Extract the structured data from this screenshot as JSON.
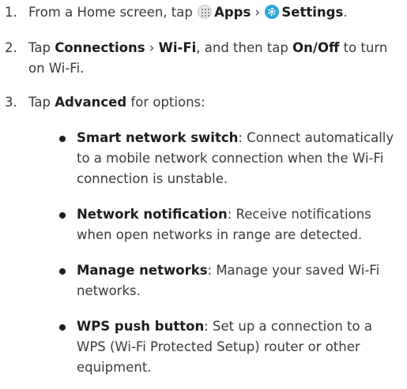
{
  "steps": [
    {
      "num": "1.",
      "pre": "From a Home screen, tap ",
      "apps": "Apps",
      "sep": " › ",
      "settings": "Settings",
      "post": "."
    },
    {
      "num": "2.",
      "pre": "Tap ",
      "connections": "Connections",
      "sep": " › ",
      "wifi": "Wi-Fi",
      "mid": ", and then tap ",
      "onoff": "On/Off",
      "post": " to turn on Wi-Fi."
    },
    {
      "num": "3.",
      "pre": "Tap ",
      "advanced": "Advanced",
      "post": " for options:"
    }
  ],
  "options": [
    {
      "term": "Smart network switch",
      "desc": ": Connect automatically to a mobile network connection when the Wi-Fi connection is unstable."
    },
    {
      "term": "Network notification",
      "desc": ": Receive notifications when open networks in range are detected."
    },
    {
      "term": "Manage networks",
      "desc": ": Manage your saved Wi-Fi networks."
    },
    {
      "term": "WPS push button",
      "desc": ": Set up a connection to a WPS (Wi-Fi Protected Setup) router or other equipment."
    }
  ],
  "icons": {
    "apps": "apps-grid-icon",
    "settings": "settings-gear-icon"
  },
  "colors": {
    "text": "#3a3a3a",
    "bold": "#1e1e1e",
    "settings_icon": "#2aa6d6"
  }
}
